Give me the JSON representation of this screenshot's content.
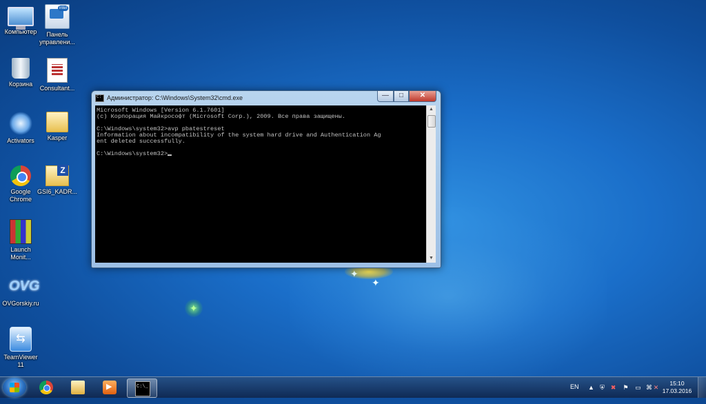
{
  "desktop": {
    "icons": [
      {
        "label": "Компьютер",
        "icon": "computer-icon"
      },
      {
        "label": "Панель управлени...",
        "icon": "control-panel-icon"
      },
      {
        "label": "Корзина",
        "icon": "recycle-bin-icon"
      },
      {
        "label": "Consultant...",
        "icon": "document-icon"
      },
      {
        "label": "Activators",
        "icon": "activators-icon"
      },
      {
        "label": "Kasper",
        "icon": "folder-icon"
      },
      {
        "label": "Google Chrome",
        "icon": "chrome-icon"
      },
      {
        "label": "GSI6_KADR...",
        "icon": "archive-folder-icon"
      },
      {
        "label": "Launch Monit...",
        "icon": "launch-monitor-icon"
      },
      {
        "label": "OVGorskiy.ru",
        "icon": "ovg-icon"
      },
      {
        "label": "TeamViewer 11",
        "icon": "teamviewer-icon"
      }
    ]
  },
  "cmd_window": {
    "title": "Администратор: C:\\Windows\\System32\\cmd.exe",
    "buttons": {
      "minimize": "—",
      "maximize": "□",
      "close": "✕"
    },
    "console_lines": [
      "Microsoft Windows [Version 6.1.7601]",
      "(c) Корпорация Майкрософт (Microsoft Corp.), 2009. Все права защищены.",
      "",
      "C:\\Windows\\system32>avp pbatestreset",
      "Information about incompatibility of the system hard drive and Authentication Ag",
      "ent deleted successfully.",
      "",
      "C:\\Windows\\system32>"
    ]
  },
  "taskbar": {
    "pinned": [
      {
        "name": "chrome",
        "icon": "chrome-icon",
        "active": false
      },
      {
        "name": "explorer",
        "icon": "folder-icon",
        "active": false
      },
      {
        "name": "media-player",
        "icon": "media-player-icon",
        "active": false
      },
      {
        "name": "cmd",
        "icon": "cmd-icon",
        "active": true
      }
    ],
    "language": "EN",
    "tray_icons": [
      "chevron-up-icon",
      "security-icon",
      "network-warning-icon",
      "flag-icon",
      "display-icon",
      "network-icon",
      "speaker-muted-icon"
    ],
    "time": "15:10",
    "date": "17.03.2016"
  }
}
